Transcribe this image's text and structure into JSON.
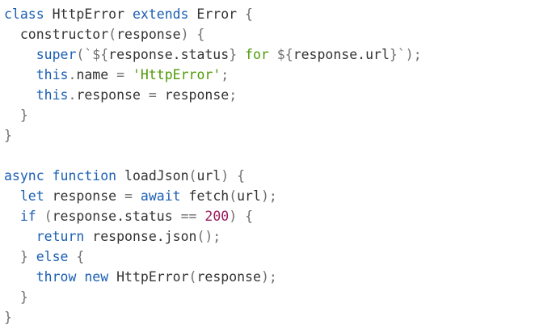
{
  "code": {
    "language": "javascript",
    "lines": [
      {
        "tokens": [
          {
            "t": "class",
            "k": "kw"
          },
          {
            "t": " HttpError ",
            "k": "id"
          },
          {
            "t": "extends",
            "k": "kw"
          },
          {
            "t": " Error ",
            "k": "id"
          },
          {
            "t": "{",
            "k": "punc"
          }
        ]
      },
      {
        "tokens": [
          {
            "t": "  constructor",
            "k": "id"
          },
          {
            "t": "(",
            "k": "punc"
          },
          {
            "t": "response",
            "k": "id"
          },
          {
            "t": ") {",
            "k": "punc"
          }
        ]
      },
      {
        "tokens": [
          {
            "t": "    ",
            "k": "id"
          },
          {
            "t": "super",
            "k": "kw"
          },
          {
            "t": "(`${",
            "k": "punc"
          },
          {
            "t": "response.status",
            "k": "id"
          },
          {
            "t": "} ",
            "k": "punc"
          },
          {
            "t": "for",
            "k": "str"
          },
          {
            "t": " ${",
            "k": "punc"
          },
          {
            "t": "response.url",
            "k": "id"
          },
          {
            "t": "}`);",
            "k": "punc"
          }
        ]
      },
      {
        "tokens": [
          {
            "t": "    ",
            "k": "id"
          },
          {
            "t": "this",
            "k": "this"
          },
          {
            "t": ".",
            "k": "punc"
          },
          {
            "t": "name ",
            "k": "id"
          },
          {
            "t": "= ",
            "k": "punc"
          },
          {
            "t": "'HttpError'",
            "k": "str"
          },
          {
            "t": ";",
            "k": "punc"
          }
        ]
      },
      {
        "tokens": [
          {
            "t": "    ",
            "k": "id"
          },
          {
            "t": "this",
            "k": "this"
          },
          {
            "t": ".",
            "k": "punc"
          },
          {
            "t": "response ",
            "k": "id"
          },
          {
            "t": "= ",
            "k": "punc"
          },
          {
            "t": "response",
            "k": "id"
          },
          {
            "t": ";",
            "k": "punc"
          }
        ]
      },
      {
        "tokens": [
          {
            "t": "  }",
            "k": "punc"
          }
        ]
      },
      {
        "tokens": [
          {
            "t": "}",
            "k": "punc"
          }
        ]
      },
      {
        "tokens": []
      },
      {
        "tokens": [
          {
            "t": "async",
            "k": "kw"
          },
          {
            "t": " ",
            "k": "id"
          },
          {
            "t": "function",
            "k": "kw"
          },
          {
            "t": " loadJson",
            "k": "id"
          },
          {
            "t": "(",
            "k": "punc"
          },
          {
            "t": "url",
            "k": "id"
          },
          {
            "t": ") {",
            "k": "punc"
          }
        ]
      },
      {
        "tokens": [
          {
            "t": "  ",
            "k": "id"
          },
          {
            "t": "let",
            "k": "kw"
          },
          {
            "t": " response ",
            "k": "id"
          },
          {
            "t": "= ",
            "k": "punc"
          },
          {
            "t": "await",
            "k": "kw"
          },
          {
            "t": " fetch",
            "k": "id"
          },
          {
            "t": "(",
            "k": "punc"
          },
          {
            "t": "url",
            "k": "id"
          },
          {
            "t": ");",
            "k": "punc"
          }
        ]
      },
      {
        "tokens": [
          {
            "t": "  ",
            "k": "id"
          },
          {
            "t": "if",
            "k": "kw"
          },
          {
            "t": " (",
            "k": "punc"
          },
          {
            "t": "response.status ",
            "k": "id"
          },
          {
            "t": "== ",
            "k": "punc"
          },
          {
            "t": "200",
            "k": "num"
          },
          {
            "t": ") {",
            "k": "punc"
          }
        ]
      },
      {
        "tokens": [
          {
            "t": "    ",
            "k": "id"
          },
          {
            "t": "return",
            "k": "kw"
          },
          {
            "t": " response.json",
            "k": "id"
          },
          {
            "t": "();",
            "k": "punc"
          }
        ]
      },
      {
        "tokens": [
          {
            "t": "  } ",
            "k": "punc"
          },
          {
            "t": "else",
            "k": "kw"
          },
          {
            "t": " {",
            "k": "punc"
          }
        ]
      },
      {
        "tokens": [
          {
            "t": "    ",
            "k": "id"
          },
          {
            "t": "throw",
            "k": "kw"
          },
          {
            "t": " ",
            "k": "id"
          },
          {
            "t": "new",
            "k": "kw"
          },
          {
            "t": " HttpError",
            "k": "id"
          },
          {
            "t": "(",
            "k": "punc"
          },
          {
            "t": "response",
            "k": "id"
          },
          {
            "t": ");",
            "k": "punc"
          }
        ]
      },
      {
        "tokens": [
          {
            "t": "  }",
            "k": "punc"
          }
        ]
      },
      {
        "tokens": [
          {
            "t": "}",
            "k": "punc"
          }
        ]
      }
    ]
  },
  "colors": {
    "background": "#ffffff",
    "keyword": "#1a5fb4",
    "string": "#4e9a06",
    "number": "#9b1b5d",
    "punctuation": "#6f6f6f",
    "identifier": "#333333"
  }
}
